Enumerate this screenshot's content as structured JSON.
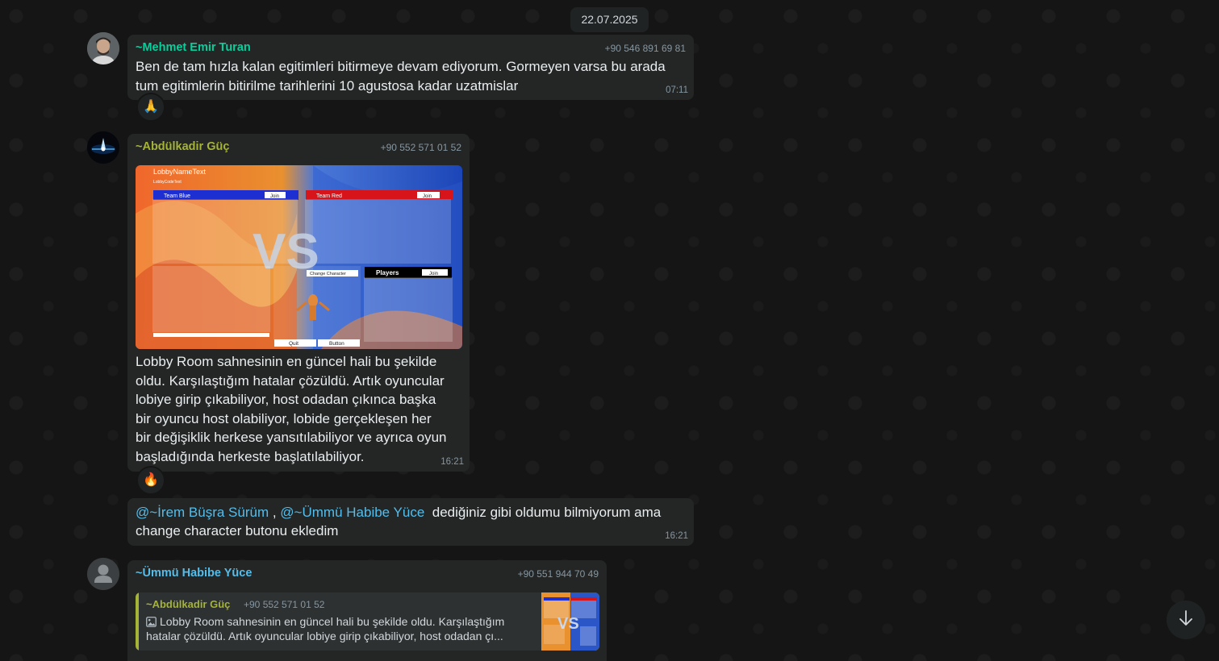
{
  "date_chip": "22.07.2025",
  "messages": [
    {
      "sender": "~Mehmet Emir Turan",
      "sender_color": "#06cf9c",
      "phone": "+90 546 891 69 81",
      "text": "Ben de tam hızla kalan egitimleri bitirmeye devam ediyorum. Gormeyen varsa bu arada\ntum egitimlerin bitirilme tarihlerini 10 agustosa kadar uzatmislar",
      "time": "07:11",
      "reaction": "🙏"
    },
    {
      "sender": "~Abdülkadir Güç",
      "sender_color": "#a5b337",
      "phone": "+90 552 571 01 52",
      "image": {
        "lobby_name": "LobbyNameText",
        "lobby_code": "LobbyCodeText",
        "team_blue": "Team Blue",
        "team_red": "Team Red",
        "join": "Join",
        "vs": "VS",
        "change_character": "Change Character",
        "players": "Players",
        "quit": "Quit",
        "button": "Button"
      },
      "text": "Lobby Room sahnesinin en güncel hali bu şekilde\noldu. Karşılaştığım hatalar çözüldü. Artık oyuncular\nlobiye girip çıkabiliyor, host odadan çıkınca başka\nbir oyuncu host olabiliyor, lobide gerçekleşen her\nbir değişiklik herkese yansıtılabiliyor ve ayrıca oyun\nbaşladığında herkeste başlatılabiliyor.",
      "time": "16:21",
      "reaction": "🔥"
    },
    {
      "mention_1": "@~İrem Büşra Sürüm",
      "separator": " , ",
      "mention_2": "@~Ümmü Habibe Yüce",
      "text_after": "  dediğiniz gibi oldumu bilmiyorum ama",
      "text_line2": "change character butonu ekledim",
      "time": "16:21"
    },
    {
      "sender": "~Ümmü Habibe Yüce",
      "sender_color": "#53bdeb",
      "phone": "+90 551 944 70 49",
      "quote": {
        "sender": "~Abdülkadir Güç",
        "phone": "+90 552 571 01 52",
        "text_line1": "Lobby Room sahnesinin en güncel hali bu şekilde oldu. Karşılaştığım",
        "text_line2": "hatalar çözüldü. Artık oyuncular lobiye girip çıkabiliyor, host odadan çı..."
      }
    }
  ],
  "colors": {
    "background": "#151515",
    "bubble": "#242626",
    "meta_text": "#8696a0",
    "mention": "#53bdeb"
  },
  "icons": {
    "scroll_down": "arrow-down-icon",
    "image": "image-icon",
    "default_avatar": "person-icon"
  }
}
